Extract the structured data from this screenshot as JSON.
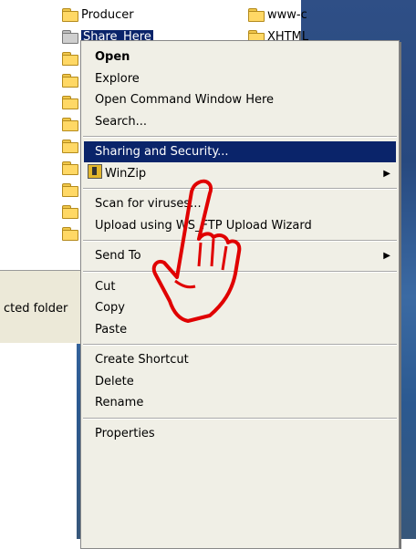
{
  "explorer": {
    "folders_left": [
      {
        "label": "Producer",
        "selected": false
      },
      {
        "label": "Share_Here",
        "selected": true
      },
      {
        "label": "",
        "selected": false
      },
      {
        "label": "",
        "selected": false
      },
      {
        "label": "",
        "selected": false
      },
      {
        "label": "",
        "selected": false
      },
      {
        "label": "",
        "selected": false
      },
      {
        "label": "",
        "selected": false
      },
      {
        "label": "",
        "selected": false
      },
      {
        "label": "",
        "selected": false
      },
      {
        "label": "",
        "selected": false
      }
    ],
    "folders_right": [
      {
        "label": "www-c"
      },
      {
        "label": "XHTML"
      }
    ],
    "status_text": "cted folder"
  },
  "context_menu": {
    "items": [
      {
        "label": "Open",
        "bold": true
      },
      {
        "label": "Explore"
      },
      {
        "label": "Open Command Window Here"
      },
      {
        "label": "Search..."
      },
      {
        "separator": true
      },
      {
        "label": "Sharing and Security...",
        "highlighted": true
      },
      {
        "label": "WinZip",
        "icon": "winzip-icon",
        "submenu": true
      },
      {
        "separator": true
      },
      {
        "label": "Scan for viruses..."
      },
      {
        "label": "Upload using WS_FTP Upload Wizard"
      },
      {
        "separator": true
      },
      {
        "label": "Send To",
        "submenu": true
      },
      {
        "separator": true
      },
      {
        "label": "Cut"
      },
      {
        "label": "Copy"
      },
      {
        "label": "Paste"
      },
      {
        "separator": true
      },
      {
        "label": "Create Shortcut"
      },
      {
        "label": "Delete"
      },
      {
        "label": "Rename"
      },
      {
        "separator": true
      },
      {
        "label": "Properties"
      }
    ]
  },
  "colors": {
    "highlight": "#0a246a",
    "menu_bg": "#f0efe6",
    "annotation_hand": "#e00000"
  },
  "annotation": {
    "icon": "pointing-hand-icon"
  }
}
